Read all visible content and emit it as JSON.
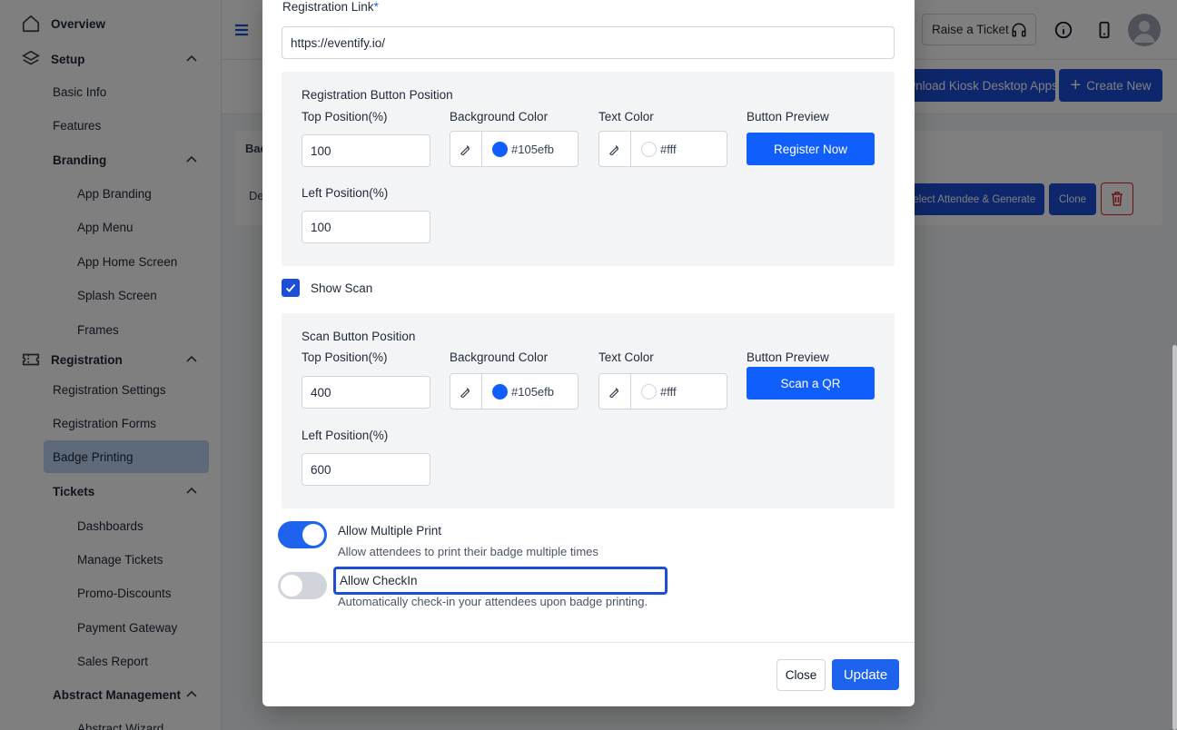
{
  "sidebar": {
    "items": [
      {
        "label": "Overview",
        "icon": "home-icon"
      },
      {
        "label": "Setup",
        "icon": "layers-icon"
      },
      {
        "label": "Basic Info"
      },
      {
        "label": "Features"
      },
      {
        "label": "Branding"
      },
      {
        "label": "App Branding"
      },
      {
        "label": "App Menu"
      },
      {
        "label": "App Home Screen"
      },
      {
        "label": "Splash Screen"
      },
      {
        "label": "Frames"
      },
      {
        "label": "Registration",
        "icon": "ticket-icon"
      },
      {
        "label": "Registration Settings"
      },
      {
        "label": "Registration Forms"
      },
      {
        "label": "Badge Printing",
        "active": true
      },
      {
        "label": "Tickets"
      },
      {
        "label": "Dashboards"
      },
      {
        "label": "Manage Tickets"
      },
      {
        "label": "Promo-Discounts"
      },
      {
        "label": "Payment Gateway"
      },
      {
        "label": "Sales Report"
      },
      {
        "label": "Abstract Management"
      },
      {
        "label": "Abstract Wizard"
      }
    ]
  },
  "topbar": {
    "raise_ticket_label": "Raise a Ticket",
    "icons": [
      "menu-icon",
      "headphones-icon",
      "info-icon",
      "mobile-icon",
      "avatar-icon"
    ]
  },
  "actions": {
    "download_label": "Download Kiosk Desktop Apps",
    "create_label": "Create New"
  },
  "table": {
    "header_partial": "Bad",
    "row_text_partial": "De",
    "select_generate_label": "Select Attendee & Generate",
    "clone_label": "Clone"
  },
  "modal": {
    "registration_link_label": "Registration Link",
    "required_mark": "*",
    "registration_link_value": "https://eventify.io/",
    "registration_button": {
      "section_title": "Registration Button Position",
      "top_label": "Top Position(%)",
      "top_value": "100",
      "bg_label": "Background Color",
      "bg_value": "#105efb",
      "text_color_label": "Text Color",
      "text_color_value": "#fff",
      "preview_label": "Button Preview",
      "preview_button_text": "Register Now",
      "left_label": "Left Position(%)",
      "left_value": "100"
    },
    "show_scan_label": "Show Scan",
    "show_scan_checked": true,
    "scan_button": {
      "section_title": "Scan Button Position",
      "top_label": "Top Position(%)",
      "top_value": "400",
      "bg_label": "Background Color",
      "bg_value": "#105efb",
      "text_color_label": "Text Color",
      "text_color_value": "#fff",
      "preview_label": "Button Preview",
      "preview_button_text": "Scan a QR",
      "left_label": "Left Position(%)",
      "left_value": "600"
    },
    "allow_multiple_print": {
      "label": "Allow Multiple Print",
      "help": "Allow attendees to print their badge multiple times",
      "enabled": true
    },
    "allow_checkin": {
      "label": "Allow CheckIn",
      "help": "Automatically check-in your attendees upon badge printing.",
      "enabled": false
    },
    "close_label": "Close",
    "update_label": "Update"
  },
  "colors": {
    "accent": "#105efb",
    "primary_button": "#1d4ed8",
    "active_sidebar_bg": "#bcd2f5",
    "overlay": "rgba(0,0,0,0.5)"
  }
}
